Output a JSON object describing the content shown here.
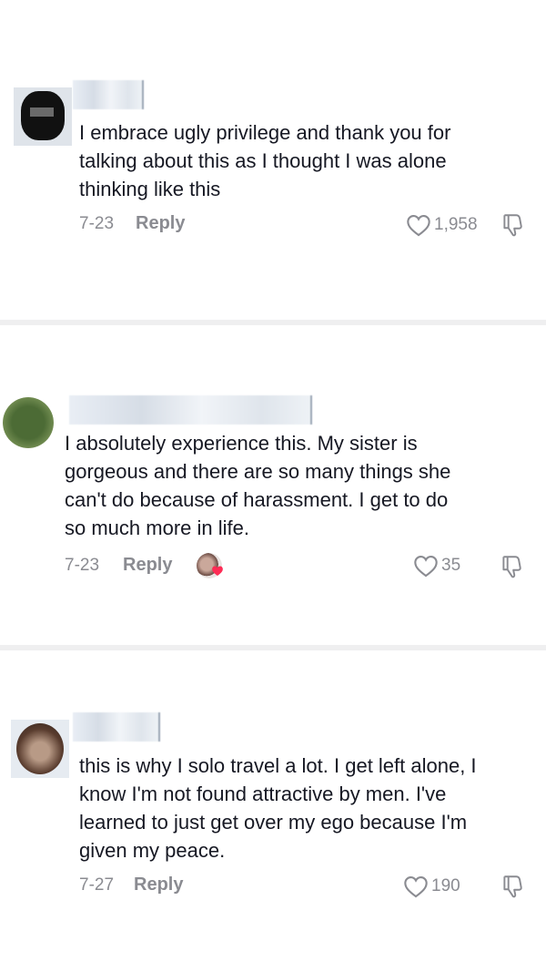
{
  "comments": [
    {
      "text": "I embrace ugly privilege and thank you for\ntalking about this as I thought I was alone\nthinking like this",
      "date": "7-23",
      "reply_label": "Reply",
      "likes": "1,958"
    },
    {
      "text": "I absolutely experience this. My sister is\ngorgeous and there are so many things she\ncan't do because of harassment. I get to do\nso much more in life.",
      "date": "7-23",
      "reply_label": "Reply",
      "likes": "35"
    },
    {
      "text": "this is why I solo travel a lot. I get left alone, I\nknow I'm not found attractive by men. I've\nlearned to just get over my ego because I'm\ngiven my peace.",
      "date": "7-27",
      "reply_label": "Reply",
      "likes": "190"
    }
  ],
  "icons": {
    "like": "heart-outline-icon",
    "dislike": "thumbs-down-icon",
    "creator_liked": "heart-filled-icon"
  },
  "colors": {
    "text": "#161823",
    "muted": "#8a8b91",
    "divider": "#efeff0",
    "creator_heart": "#fe2c55"
  }
}
